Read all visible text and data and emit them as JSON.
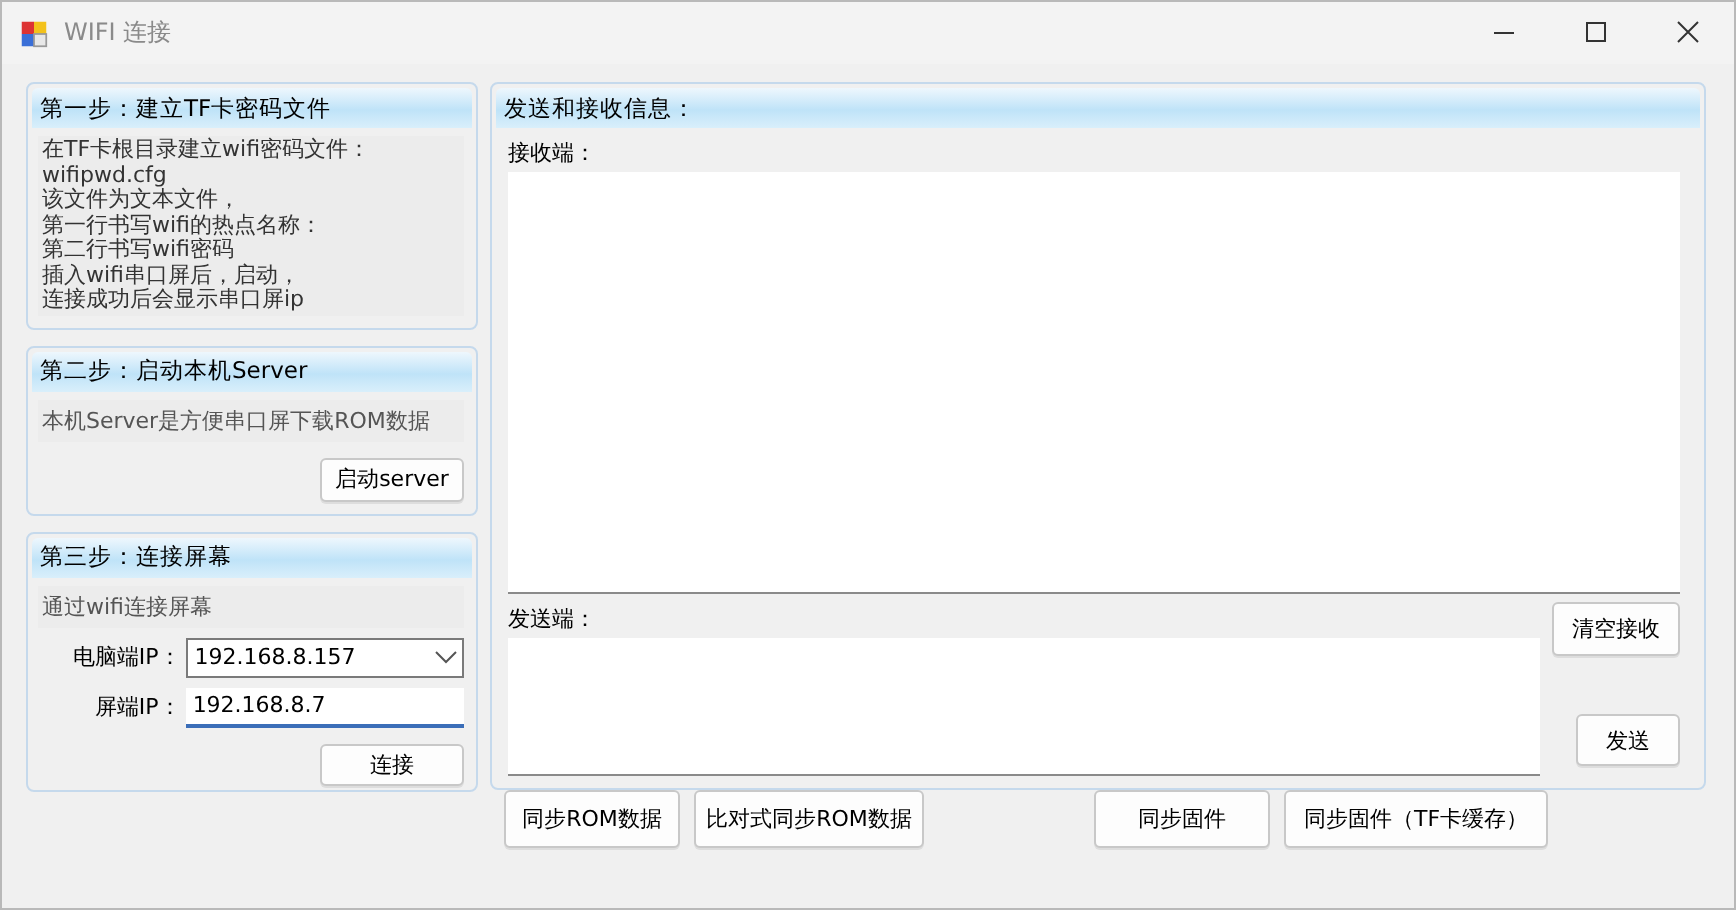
{
  "window": {
    "title": "WIFI 连接"
  },
  "steps": [
    {
      "kind": "info",
      "title": "第一步：建立TF卡密码文件",
      "lines": [
        "在TF卡根目录建立wifi密码文件：",
        "wifipwd.cfg",
        "该文件为文本文件，",
        "第一行书写wifi的热点名称：",
        "第二行书写wifi密码",
        "插入wifi串口屏后，启动，",
        "连接成功后会显示串口屏ip"
      ]
    },
    {
      "kind": "server",
      "title": "第二步：启动本机Server",
      "description": "本机Server是方便串口屏下载ROM数据",
      "button": "启动server"
    },
    {
      "kind": "connect",
      "title": "第三步：连接屏幕",
      "description": "通过wifi连接屏幕",
      "fields": [
        {
          "kind": "dropdown",
          "label": "电脑端IP：",
          "value": "192.168.8.157",
          "focused": false
        },
        {
          "kind": "text",
          "label": "屏端IP：",
          "value": "192.168.8.7",
          "focused": true
        }
      ],
      "button": "连接"
    }
  ],
  "messages": {
    "title": "发送和接收信息：",
    "receive_label": "接收端：",
    "send_label": "发送端：",
    "clear_button": "清空接收",
    "send_button": "发送"
  },
  "bottom_buttons": [
    "同步ROM数据",
    "比对式同步ROM数据",
    "同步固件",
    "同步固件（TF卡缓存）"
  ]
}
